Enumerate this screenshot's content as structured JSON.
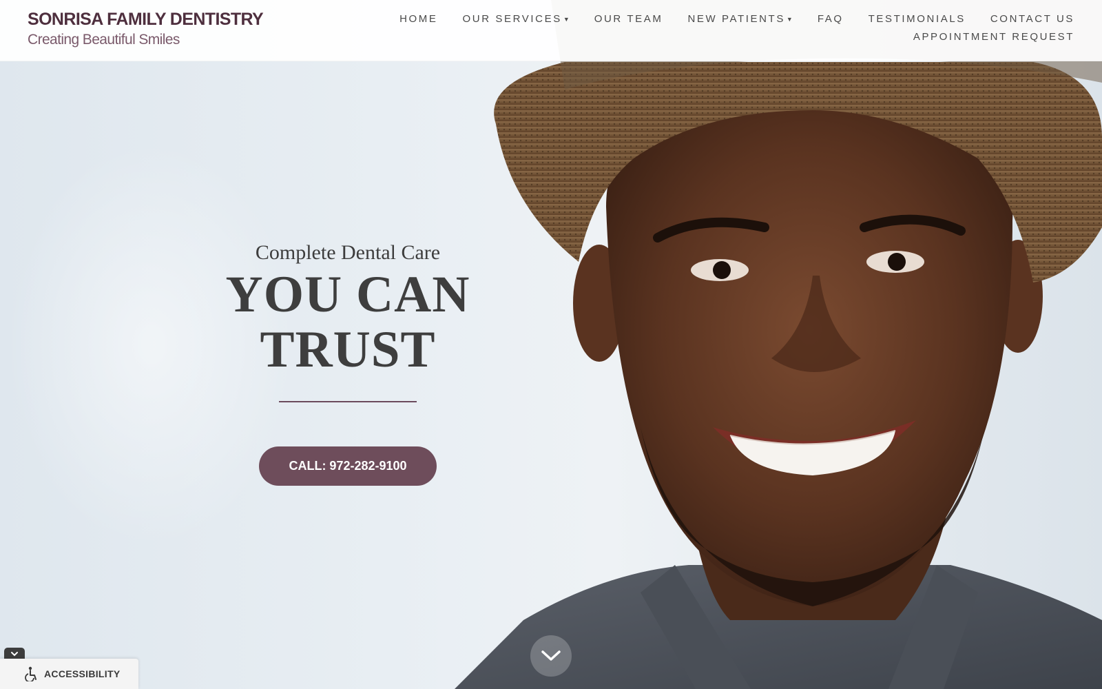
{
  "header": {
    "brand_name": "SONRISA FAMILY DENTISTRY",
    "tagline": "Creating Beautiful Smiles"
  },
  "nav": {
    "row1": [
      {
        "label": "HOME",
        "has_dropdown": false
      },
      {
        "label": "OUR SERVICES",
        "has_dropdown": true
      },
      {
        "label": "OUR TEAM",
        "has_dropdown": false
      },
      {
        "label": "NEW PATIENTS",
        "has_dropdown": true
      },
      {
        "label": "FAQ",
        "has_dropdown": false
      },
      {
        "label": "TESTIMONIALS",
        "has_dropdown": false
      },
      {
        "label": "CONTACT US",
        "has_dropdown": false
      }
    ],
    "row2": [
      {
        "label": "APPOINTMENT REQUEST",
        "has_dropdown": false
      }
    ]
  },
  "hero": {
    "eyebrow": "Complete Dental Care",
    "headline_line1": "YOU CAN",
    "headline_line2": "TRUST",
    "cta_label": "CALL:  972-282-9100"
  },
  "accessibility": {
    "label": "ACCESSIBILITY"
  },
  "icons": {
    "scroll": "chevron-down-icon",
    "accessibility": "wheelchair-icon",
    "toggle": "chevron-down-icon"
  },
  "colors": {
    "brand": "#4e2f3e",
    "accent": "#6e4d5b",
    "nav_text": "#4a4a4a",
    "headline": "#3e3e3e"
  }
}
